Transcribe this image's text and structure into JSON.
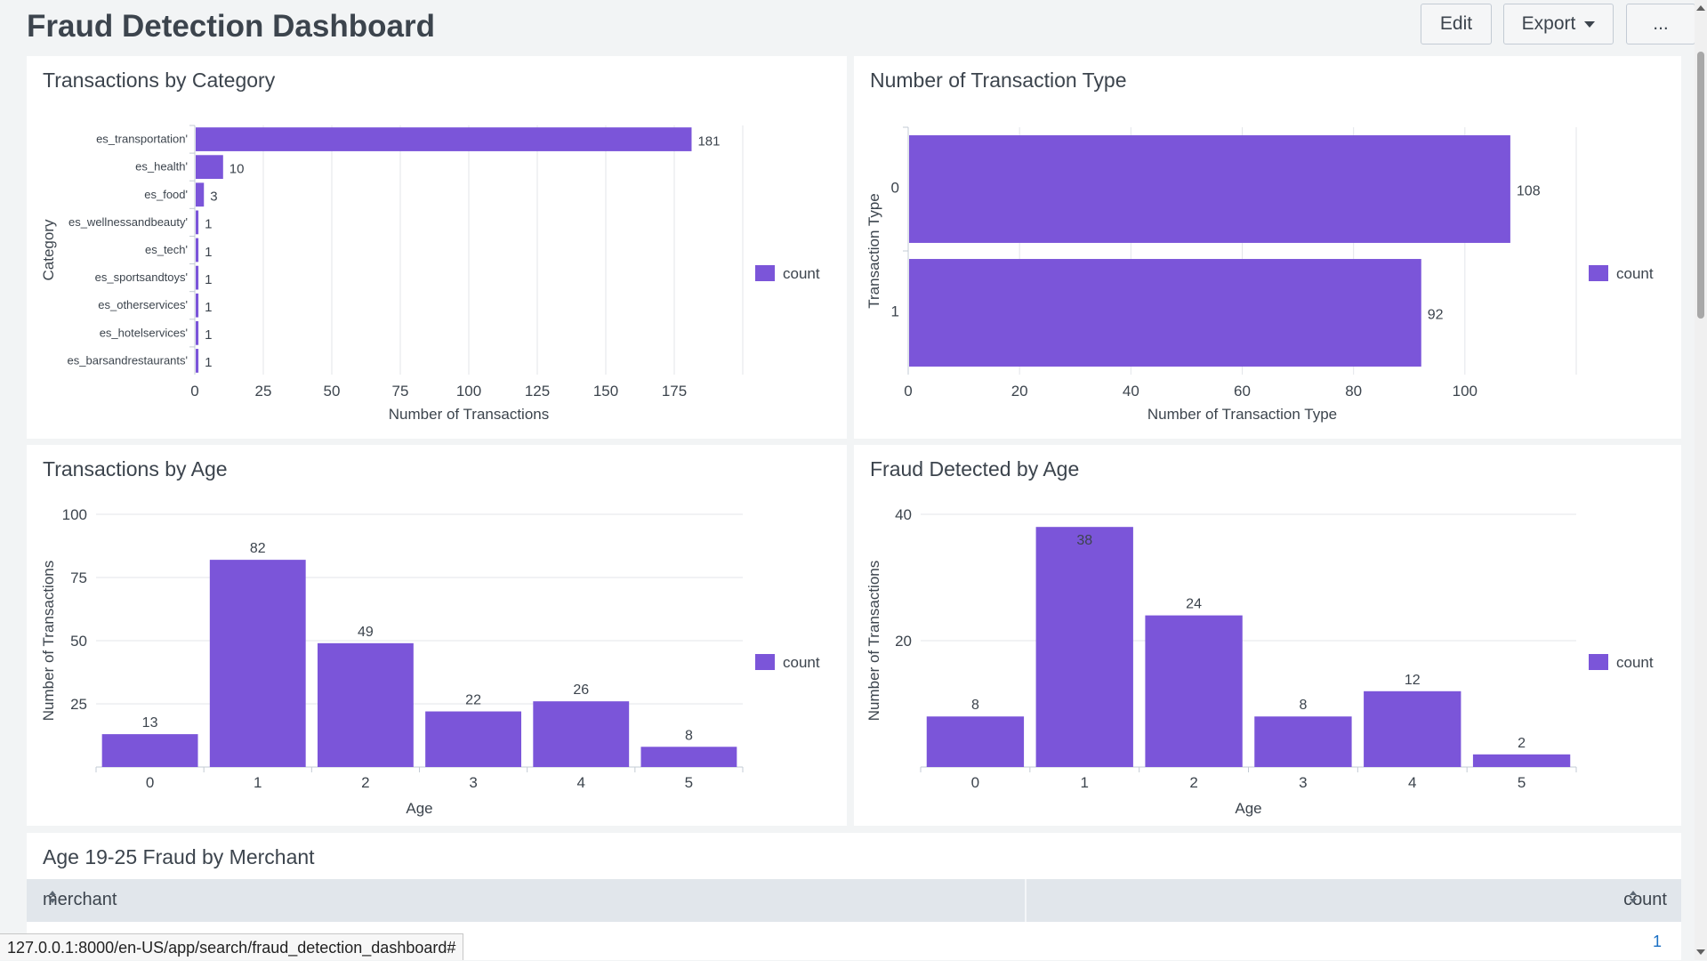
{
  "header": {
    "title": "Fraud Detection Dashboard",
    "edit_label": "Edit",
    "export_label": "Export",
    "more_label": "..."
  },
  "colors": {
    "bar": "#7b55d9",
    "grid": "#e3e6ea",
    "axis": "#c3cbd4"
  },
  "panels": {
    "category": {
      "title": "Transactions by Category"
    },
    "type": {
      "title": "Number of Transaction Type"
    },
    "age": {
      "title": "Transactions by Age"
    },
    "fraud_age": {
      "title": "Fraud Detected by Age"
    },
    "merchant": {
      "title": "Age 19-25 Fraud by Merchant"
    }
  },
  "table": {
    "columns": [
      "merchant",
      "count"
    ],
    "rows": [
      {
        "merchant": "",
        "count": "1"
      }
    ]
  },
  "statusbar": {
    "url": "127.0.0.1:8000/en-US/app/search/fraud_detection_dashboard#"
  },
  "chart_data": [
    {
      "type": "bar",
      "orientation": "horizontal",
      "title": "Transactions by Category",
      "categories": [
        "es_transportation'",
        "es_health'",
        "es_food'",
        "es_wellnessandbeauty'",
        "es_tech'",
        "es_sportsandtoys'",
        "es_otherservices'",
        "es_hotelservices'",
        "es_barsandrestaurants'"
      ],
      "series": [
        {
          "name": "count",
          "values": [
            181,
            10,
            3,
            1,
            1,
            1,
            1,
            1,
            1
          ]
        }
      ],
      "xlabel": "Number of Transactions",
      "ylabel": "Category",
      "xlim": [
        0,
        200
      ],
      "xticks": [
        0,
        25,
        50,
        75,
        100,
        125,
        150,
        175
      ],
      "grid": true,
      "legend": "right"
    },
    {
      "type": "bar",
      "orientation": "horizontal",
      "title": "Number of Transaction Type",
      "categories": [
        "0",
        "1"
      ],
      "series": [
        {
          "name": "count",
          "values": [
            108,
            92
          ]
        }
      ],
      "xlabel": "Number of Transaction Type",
      "ylabel": "Transaction Type",
      "xlim": [
        0,
        120
      ],
      "xticks": [
        0,
        20,
        40,
        60,
        80,
        100
      ],
      "grid": true,
      "legend": "right"
    },
    {
      "type": "bar",
      "orientation": "vertical",
      "title": "Transactions by Age",
      "categories": [
        "0",
        "1",
        "2",
        "3",
        "4",
        "5"
      ],
      "series": [
        {
          "name": "count",
          "values": [
            13,
            82,
            49,
            22,
            26,
            8
          ]
        }
      ],
      "xlabel": "Age",
      "ylabel": "Number of Transactions",
      "ylim": [
        0,
        100
      ],
      "yticks": [
        25,
        50,
        75,
        100
      ],
      "grid": true,
      "legend": "right"
    },
    {
      "type": "bar",
      "orientation": "vertical",
      "title": "Fraud Detected by Age",
      "categories": [
        "0",
        "1",
        "2",
        "3",
        "4",
        "5"
      ],
      "series": [
        {
          "name": "count",
          "values": [
            8,
            38,
            24,
            8,
            12,
            2
          ]
        }
      ],
      "xlabel": "Age",
      "ylabel": "Number of Transactions",
      "ylim": [
        0,
        40
      ],
      "yticks": [
        20,
        40
      ],
      "grid": true,
      "legend": "right"
    }
  ]
}
